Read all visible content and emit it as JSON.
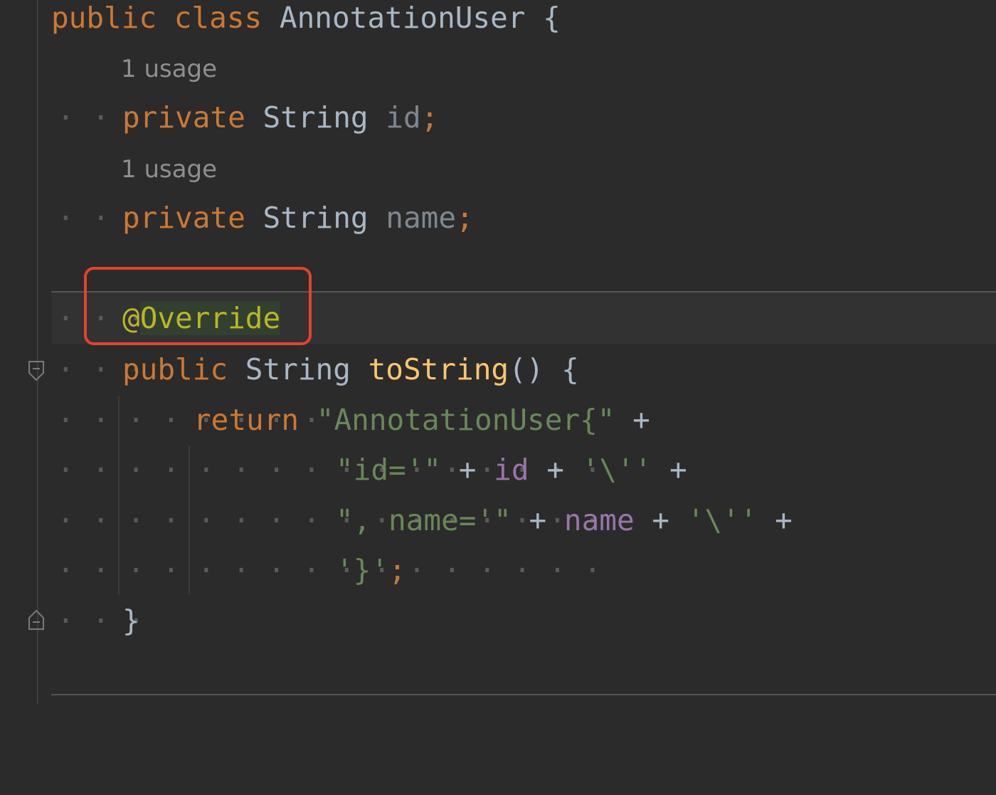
{
  "editor": {
    "lines": [
      {
        "id": "class-decl",
        "tokens": [
          {
            "t": "public",
            "c": "kw"
          },
          {
            "t": " ",
            "c": "plain"
          },
          {
            "t": "class",
            "c": "kw"
          },
          {
            "t": " ",
            "c": "plain"
          },
          {
            "t": "AnnotationUser",
            "c": "plain"
          },
          {
            "t": " {",
            "c": "plain"
          }
        ]
      },
      {
        "id": "field-id",
        "tokens": [
          {
            "t": "private",
            "c": "kw"
          },
          {
            "t": " ",
            "c": "plain"
          },
          {
            "t": "String",
            "c": "plain"
          },
          {
            "t": " ",
            "c": "plain"
          },
          {
            "t": "id",
            "c": "fieldgray"
          },
          {
            "t": ";",
            "c": "semi"
          }
        ]
      },
      {
        "id": "field-name",
        "tokens": [
          {
            "t": "private",
            "c": "kw"
          },
          {
            "t": " ",
            "c": "plain"
          },
          {
            "t": "String",
            "c": "plain"
          },
          {
            "t": " ",
            "c": "plain"
          },
          {
            "t": "name",
            "c": "fieldgray"
          },
          {
            "t": ";",
            "c": "semi"
          }
        ]
      },
      {
        "id": "annotation",
        "tokens": [
          {
            "t": "@",
            "c": "ann"
          },
          {
            "t": "Override",
            "c": "ann ann-bg"
          }
        ]
      },
      {
        "id": "method-decl",
        "tokens": [
          {
            "t": "public",
            "c": "kw"
          },
          {
            "t": " ",
            "c": "plain"
          },
          {
            "t": "String",
            "c": "plain"
          },
          {
            "t": " ",
            "c": "plain"
          },
          {
            "t": "toString",
            "c": "method"
          },
          {
            "t": "() {",
            "c": "plain"
          }
        ]
      },
      {
        "id": "return-line",
        "tokens": [
          {
            "t": "return",
            "c": "kw"
          },
          {
            "t": " ",
            "c": "plain"
          },
          {
            "t": "\"AnnotationUser{\"",
            "c": "str"
          },
          {
            "t": " +",
            "c": "plain"
          }
        ]
      },
      {
        "id": "concat-id",
        "tokens": [
          {
            "t": "\"id='\"",
            "c": "str"
          },
          {
            "t": " + ",
            "c": "plain"
          },
          {
            "t": "id",
            "c": "field"
          },
          {
            "t": " + ",
            "c": "plain"
          },
          {
            "t": "'\\''",
            "c": "str"
          },
          {
            "t": " +",
            "c": "plain"
          }
        ]
      },
      {
        "id": "concat-name",
        "tokens": [
          {
            "t": "\", name='\"",
            "c": "str"
          },
          {
            "t": " + ",
            "c": "plain"
          },
          {
            "t": "name",
            "c": "field"
          },
          {
            "t": " + ",
            "c": "plain"
          },
          {
            "t": "'\\''",
            "c": "str"
          },
          {
            "t": " +",
            "c": "plain"
          }
        ]
      },
      {
        "id": "close-brace-str",
        "tokens": [
          {
            "t": "'}'",
            "c": "str"
          },
          {
            "t": ";",
            "c": "semi"
          }
        ]
      },
      {
        "id": "method-close",
        "tokens": [
          {
            "t": "}",
            "c": "plain"
          }
        ]
      }
    ],
    "usage_hints": [
      "1 usage",
      "1 usage"
    ]
  },
  "colors": {
    "background": "#2b2b2b",
    "keyword": "#cc7832",
    "string": "#6a8759",
    "method": "#ffc66d",
    "annotation": "#bbb529",
    "field": "#9876aa",
    "highlight_box": "#e8412b"
  }
}
